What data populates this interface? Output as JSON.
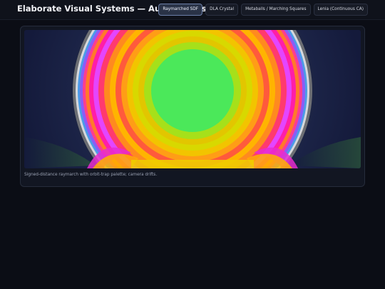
{
  "app": {
    "title": "Elaborate Visual Systems — Autonomous"
  },
  "tabs": [
    {
      "label": "Raymarched SDF",
      "active": true
    },
    {
      "label": "DLA Crystal",
      "active": false
    },
    {
      "label": "Metaballs / Marching Squares",
      "active": false
    },
    {
      "label": "Lenia (Continuous CA)",
      "active": false
    }
  ],
  "viewer": {
    "caption": "Signed-distance raymarch with orbit-trap palette; camera drifts."
  },
  "colors": {
    "background": "#0b0d15",
    "active_tab": "#2a3347",
    "canvas_bg": "#141a3b"
  }
}
